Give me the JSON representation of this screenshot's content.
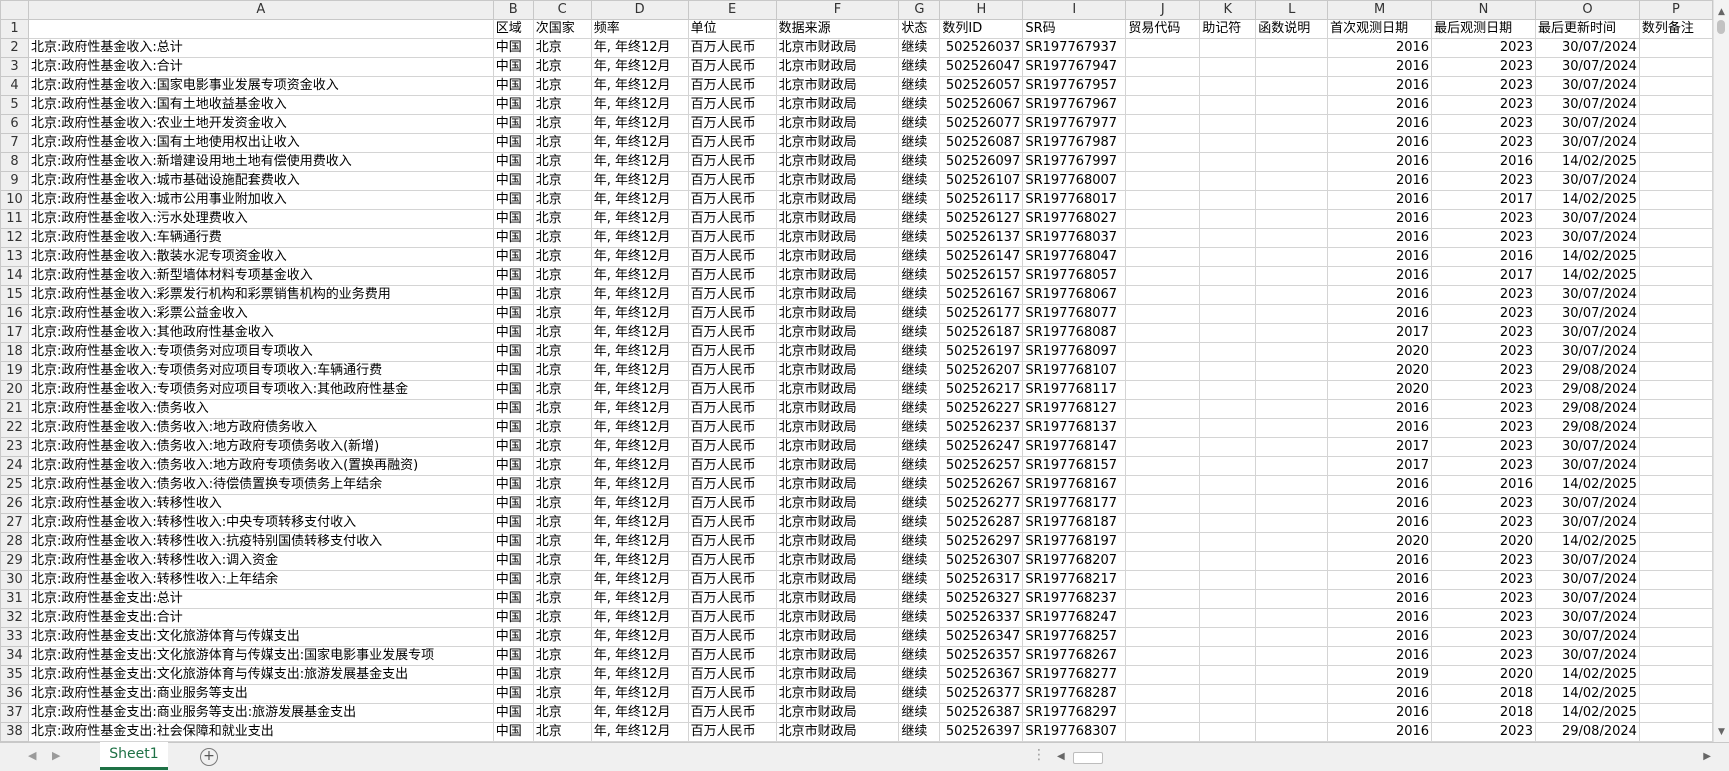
{
  "columns": [
    "A",
    "B",
    "C",
    "D",
    "E",
    "F",
    "G",
    "H",
    "I",
    "J",
    "K",
    "L",
    "M",
    "N",
    "O",
    "P"
  ],
  "header": [
    "",
    "区域",
    "次国家",
    "频率",
    "单位",
    "数据来源",
    "状态",
    "数列ID",
    "SR码",
    "贸易代码",
    "助记符",
    "函数说明",
    "首次观测日期",
    "最后观测日期",
    "最后更新时间",
    "数列备注"
  ],
  "rows": [
    [
      "北京:政府性基金收入:总计",
      "中国",
      "北京",
      "年, 年终12月",
      "百万人民币",
      "北京市财政局",
      "继续",
      "502526037",
      "SR197767937",
      "",
      "",
      "",
      "2016",
      "2023",
      "30/07/2024",
      ""
    ],
    [
      "北京:政府性基金收入:合计",
      "中国",
      "北京",
      "年, 年终12月",
      "百万人民币",
      "北京市财政局",
      "继续",
      "502526047",
      "SR197767947",
      "",
      "",
      "",
      "2016",
      "2023",
      "30/07/2024",
      ""
    ],
    [
      "北京:政府性基金收入:国家电影事业发展专项资金收入",
      "中国",
      "北京",
      "年, 年终12月",
      "百万人民币",
      "北京市财政局",
      "继续",
      "502526057",
      "SR197767957",
      "",
      "",
      "",
      "2016",
      "2023",
      "30/07/2024",
      ""
    ],
    [
      "北京:政府性基金收入:国有土地收益基金收入",
      "中国",
      "北京",
      "年, 年终12月",
      "百万人民币",
      "北京市财政局",
      "继续",
      "502526067",
      "SR197767967",
      "",
      "",
      "",
      "2016",
      "2023",
      "30/07/2024",
      ""
    ],
    [
      "北京:政府性基金收入:农业土地开发资金收入",
      "中国",
      "北京",
      "年, 年终12月",
      "百万人民币",
      "北京市财政局",
      "继续",
      "502526077",
      "SR197767977",
      "",
      "",
      "",
      "2016",
      "2023",
      "30/07/2024",
      ""
    ],
    [
      "北京:政府性基金收入:国有土地使用权出让收入",
      "中国",
      "北京",
      "年, 年终12月",
      "百万人民币",
      "北京市财政局",
      "继续",
      "502526087",
      "SR197767987",
      "",
      "",
      "",
      "2016",
      "2023",
      "30/07/2024",
      ""
    ],
    [
      "北京:政府性基金收入:新增建设用地土地有偿使用费收入",
      "中国",
      "北京",
      "年, 年终12月",
      "百万人民币",
      "北京市财政局",
      "继续",
      "502526097",
      "SR197767997",
      "",
      "",
      "",
      "2016",
      "2016",
      "14/02/2025",
      ""
    ],
    [
      "北京:政府性基金收入:城市基础设施配套费收入",
      "中国",
      "北京",
      "年, 年终12月",
      "百万人民币",
      "北京市财政局",
      "继续",
      "502526107",
      "SR197768007",
      "",
      "",
      "",
      "2016",
      "2023",
      "30/07/2024",
      ""
    ],
    [
      "北京:政府性基金收入:城市公用事业附加收入",
      "中国",
      "北京",
      "年, 年终12月",
      "百万人民币",
      "北京市财政局",
      "继续",
      "502526117",
      "SR197768017",
      "",
      "",
      "",
      "2016",
      "2017",
      "14/02/2025",
      ""
    ],
    [
      "北京:政府性基金收入:污水处理费收入",
      "中国",
      "北京",
      "年, 年终12月",
      "百万人民币",
      "北京市财政局",
      "继续",
      "502526127",
      "SR197768027",
      "",
      "",
      "",
      "2016",
      "2023",
      "30/07/2024",
      ""
    ],
    [
      "北京:政府性基金收入:车辆通行费",
      "中国",
      "北京",
      "年, 年终12月",
      "百万人民币",
      "北京市财政局",
      "继续",
      "502526137",
      "SR197768037",
      "",
      "",
      "",
      "2016",
      "2023",
      "30/07/2024",
      ""
    ],
    [
      "北京:政府性基金收入:散装水泥专项资金收入",
      "中国",
      "北京",
      "年, 年终12月",
      "百万人民币",
      "北京市财政局",
      "继续",
      "502526147",
      "SR197768047",
      "",
      "",
      "",
      "2016",
      "2016",
      "14/02/2025",
      ""
    ],
    [
      "北京:政府性基金收入:新型墙体材料专项基金收入",
      "中国",
      "北京",
      "年, 年终12月",
      "百万人民币",
      "北京市财政局",
      "继续",
      "502526157",
      "SR197768057",
      "",
      "",
      "",
      "2016",
      "2017",
      "14/02/2025",
      ""
    ],
    [
      "北京:政府性基金收入:彩票发行机构和彩票销售机构的业务费用",
      "中国",
      "北京",
      "年, 年终12月",
      "百万人民币",
      "北京市财政局",
      "继续",
      "502526167",
      "SR197768067",
      "",
      "",
      "",
      "2016",
      "2023",
      "30/07/2024",
      ""
    ],
    [
      "北京:政府性基金收入:彩票公益金收入",
      "中国",
      "北京",
      "年, 年终12月",
      "百万人民币",
      "北京市财政局",
      "继续",
      "502526177",
      "SR197768077",
      "",
      "",
      "",
      "2016",
      "2023",
      "30/07/2024",
      ""
    ],
    [
      "北京:政府性基金收入:其他政府性基金收入",
      "中国",
      "北京",
      "年, 年终12月",
      "百万人民币",
      "北京市财政局",
      "继续",
      "502526187",
      "SR197768087",
      "",
      "",
      "",
      "2017",
      "2023",
      "30/07/2024",
      ""
    ],
    [
      "北京:政府性基金收入:专项债务对应项目专项收入",
      "中国",
      "北京",
      "年, 年终12月",
      "百万人民币",
      "北京市财政局",
      "继续",
      "502526197",
      "SR197768097",
      "",
      "",
      "",
      "2020",
      "2023",
      "30/07/2024",
      ""
    ],
    [
      "北京:政府性基金收入:专项债务对应项目专项收入:车辆通行费",
      "中国",
      "北京",
      "年, 年终12月",
      "百万人民币",
      "北京市财政局",
      "继续",
      "502526207",
      "SR197768107",
      "",
      "",
      "",
      "2020",
      "2023",
      "29/08/2024",
      ""
    ],
    [
      "北京:政府性基金收入:专项债务对应项目专项收入:其他政府性基金",
      "中国",
      "北京",
      "年, 年终12月",
      "百万人民币",
      "北京市财政局",
      "继续",
      "502526217",
      "SR197768117",
      "",
      "",
      "",
      "2020",
      "2023",
      "29/08/2024",
      ""
    ],
    [
      "北京:政府性基金收入:债务收入",
      "中国",
      "北京",
      "年, 年终12月",
      "百万人民币",
      "北京市财政局",
      "继续",
      "502526227",
      "SR197768127",
      "",
      "",
      "",
      "2016",
      "2023",
      "29/08/2024",
      ""
    ],
    [
      "北京:政府性基金收入:债务收入:地方政府债务收入",
      "中国",
      "北京",
      "年, 年终12月",
      "百万人民币",
      "北京市财政局",
      "继续",
      "502526237",
      "SR197768137",
      "",
      "",
      "",
      "2016",
      "2023",
      "29/08/2024",
      ""
    ],
    [
      "北京:政府性基金收入:债务收入:地方政府专项债务收入(新增)",
      "中国",
      "北京",
      "年, 年终12月",
      "百万人民币",
      "北京市财政局",
      "继续",
      "502526247",
      "SR197768147",
      "",
      "",
      "",
      "2017",
      "2023",
      "30/07/2024",
      ""
    ],
    [
      "北京:政府性基金收入:债务收入:地方政府专项债务收入(置换再融资)",
      "中国",
      "北京",
      "年, 年终12月",
      "百万人民币",
      "北京市财政局",
      "继续",
      "502526257",
      "SR197768157",
      "",
      "",
      "",
      "2017",
      "2023",
      "30/07/2024",
      ""
    ],
    [
      "北京:政府性基金收入:债务收入:待偿债置换专项债务上年结余",
      "中国",
      "北京",
      "年, 年终12月",
      "百万人民币",
      "北京市财政局",
      "继续",
      "502526267",
      "SR197768167",
      "",
      "",
      "",
      "2016",
      "2016",
      "14/02/2025",
      ""
    ],
    [
      "北京:政府性基金收入:转移性收入",
      "中国",
      "北京",
      "年, 年终12月",
      "百万人民币",
      "北京市财政局",
      "继续",
      "502526277",
      "SR197768177",
      "",
      "",
      "",
      "2016",
      "2023",
      "30/07/2024",
      ""
    ],
    [
      "北京:政府性基金收入:转移性收入:中央专项转移支付收入",
      "中国",
      "北京",
      "年, 年终12月",
      "百万人民币",
      "北京市财政局",
      "继续",
      "502526287",
      "SR197768187",
      "",
      "",
      "",
      "2016",
      "2023",
      "30/07/2024",
      ""
    ],
    [
      "北京:政府性基金收入:转移性收入:抗疫特别国债转移支付收入",
      "中国",
      "北京",
      "年, 年终12月",
      "百万人民币",
      "北京市财政局",
      "继续",
      "502526297",
      "SR197768197",
      "",
      "",
      "",
      "2020",
      "2020",
      "14/02/2025",
      ""
    ],
    [
      "北京:政府性基金收入:转移性收入:调入资金",
      "中国",
      "北京",
      "年, 年终12月",
      "百万人民币",
      "北京市财政局",
      "继续",
      "502526307",
      "SR197768207",
      "",
      "",
      "",
      "2016",
      "2023",
      "30/07/2024",
      ""
    ],
    [
      "北京:政府性基金收入:转移性收入:上年结余",
      "中国",
      "北京",
      "年, 年终12月",
      "百万人民币",
      "北京市财政局",
      "继续",
      "502526317",
      "SR197768217",
      "",
      "",
      "",
      "2016",
      "2023",
      "30/07/2024",
      ""
    ],
    [
      "北京:政府性基金支出:总计",
      "中国",
      "北京",
      "年, 年终12月",
      "百万人民币",
      "北京市财政局",
      "继续",
      "502526327",
      "SR197768237",
      "",
      "",
      "",
      "2016",
      "2023",
      "30/07/2024",
      ""
    ],
    [
      "北京:政府性基金支出:合计",
      "中国",
      "北京",
      "年, 年终12月",
      "百万人民币",
      "北京市财政局",
      "继续",
      "502526337",
      "SR197768247",
      "",
      "",
      "",
      "2016",
      "2023",
      "30/07/2024",
      ""
    ],
    [
      "北京:政府性基金支出:文化旅游体育与传媒支出",
      "中国",
      "北京",
      "年, 年终12月",
      "百万人民币",
      "北京市财政局",
      "继续",
      "502526347",
      "SR197768257",
      "",
      "",
      "",
      "2016",
      "2023",
      "30/07/2024",
      ""
    ],
    [
      "北京:政府性基金支出:文化旅游体育与传媒支出:国家电影事业发展专项",
      "中国",
      "北京",
      "年, 年终12月",
      "百万人民币",
      "北京市财政局",
      "继续",
      "502526357",
      "SR197768267",
      "",
      "",
      "",
      "2016",
      "2023",
      "30/07/2024",
      ""
    ],
    [
      "北京:政府性基金支出:文化旅游体育与传媒支出:旅游发展基金支出",
      "中国",
      "北京",
      "年, 年终12月",
      "百万人民币",
      "北京市财政局",
      "继续",
      "502526367",
      "SR197768277",
      "",
      "",
      "",
      "2019",
      "2020",
      "14/02/2025",
      ""
    ],
    [
      "北京:政府性基金支出:商业服务等支出",
      "中国",
      "北京",
      "年, 年终12月",
      "百万人民币",
      "北京市财政局",
      "继续",
      "502526377",
      "SR197768287",
      "",
      "",
      "",
      "2016",
      "2018",
      "14/02/2025",
      ""
    ],
    [
      "北京:政府性基金支出:商业服务等支出:旅游发展基金支出",
      "中国",
      "北京",
      "年, 年终12月",
      "百万人民币",
      "北京市财政局",
      "继续",
      "502526387",
      "SR197768297",
      "",
      "",
      "",
      "2016",
      "2018",
      "14/02/2025",
      ""
    ],
    [
      "北京:政府性基金支出:社会保障和就业支出",
      "中国",
      "北京",
      "年, 年终12月",
      "百万人民币",
      "北京市财政局",
      "继续",
      "502526397",
      "SR197768307",
      "",
      "",
      "",
      "2016",
      "2023",
      "29/08/2024",
      ""
    ]
  ],
  "sheet_tab": "Sheet1",
  "add_sheet_icon": "+",
  "nav_prev_icon": "◀",
  "nav_next_icon": "▶",
  "dots": "⋮",
  "scroll_up_icon": "▲",
  "scroll_down_icon": "▼",
  "scroll_left_icon": "◀",
  "scroll_right_icon": "▶",
  "accent_color": "#1e7145"
}
